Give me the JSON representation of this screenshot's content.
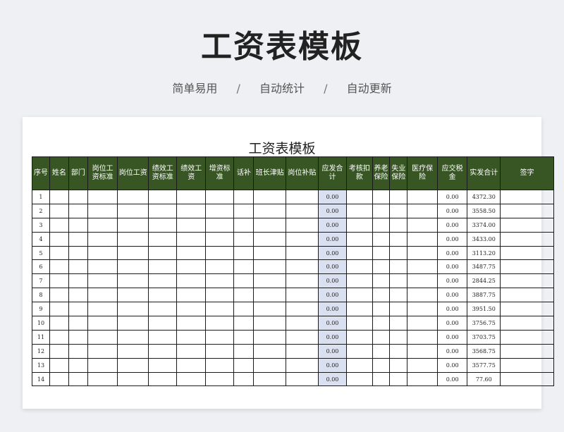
{
  "hero": {
    "title": "工资表模板",
    "subtitle": [
      "简单易用",
      "自动统计",
      "自动更新"
    ],
    "separator": "/"
  },
  "sheet": {
    "title": "工资表模板",
    "columns": [
      "序号",
      "姓名",
      "部门",
      "岗位工资标准",
      "岗位工资",
      "绩效工资标准",
      "绩效工资",
      "增资标准",
      "话补",
      "班长津贴",
      "岗位补贴",
      "应发合计",
      "考核扣款",
      "养老保险",
      "失业保险",
      "医疗保险",
      "应交税金",
      "实发合计",
      "签字"
    ],
    "rows": [
      {
        "no": "1",
        "gross": "0.00",
        "tax": "0.00",
        "net": "4372.30"
      },
      {
        "no": "2",
        "gross": "0.00",
        "tax": "0.00",
        "net": "3558.50"
      },
      {
        "no": "3",
        "gross": "0.00",
        "tax": "0.00",
        "net": "3374.00"
      },
      {
        "no": "4",
        "gross": "0.00",
        "tax": "0.00",
        "net": "3433.00"
      },
      {
        "no": "5",
        "gross": "0.00",
        "tax": "0.00",
        "net": "3113.20"
      },
      {
        "no": "6",
        "gross": "0.00",
        "tax": "0.00",
        "net": "3487.75"
      },
      {
        "no": "7",
        "gross": "0.00",
        "tax": "0.00",
        "net": "2844.25"
      },
      {
        "no": "8",
        "gross": "0.00",
        "tax": "0.00",
        "net": "3887.75"
      },
      {
        "no": "9",
        "gross": "0.00",
        "tax": "0.00",
        "net": "3951.50"
      },
      {
        "no": "10",
        "gross": "0.00",
        "tax": "0.00",
        "net": "3756.75"
      },
      {
        "no": "11",
        "gross": "0.00",
        "tax": "0.00",
        "net": "3703.75"
      },
      {
        "no": "12",
        "gross": "0.00",
        "tax": "0.00",
        "net": "3568.75"
      },
      {
        "no": "13",
        "gross": "0.00",
        "tax": "0.00",
        "net": "3577.75"
      },
      {
        "no": "14",
        "gross": "0.00",
        "tax": "0.00",
        "net": "77.60"
      }
    ]
  },
  "colors": {
    "header_bg": "#375623",
    "header_text": "#ffffff",
    "gross_column_bg": "#dbe0f1",
    "page_bg": "#eef0f3"
  }
}
